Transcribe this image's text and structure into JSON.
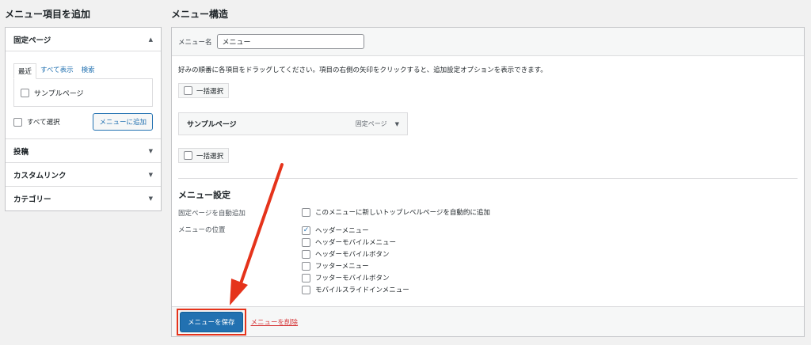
{
  "left": {
    "heading": "メニュー項目を追加",
    "pages_section": {
      "title": "固定ページ",
      "tabs": [
        "最近",
        "すべて表示",
        "検索"
      ],
      "items": [
        "サンプルページ"
      ],
      "select_all": "すべて選択",
      "add_button": "メニューに追加"
    },
    "sections": [
      "投稿",
      "カスタムリンク",
      "カテゴリー"
    ]
  },
  "right": {
    "heading": "メニュー構造",
    "name_label": "メニュー名",
    "name_value": "メニュー",
    "instructions": "好みの順番に各項目をドラッグしてください。項目の右側の矢印をクリックすると、追加設定オプションを表示できます。",
    "bulk_select": "一括選択",
    "menu_item": {
      "title": "サンプルページ",
      "type": "固定ページ"
    },
    "settings": {
      "title": "メニュー設定",
      "auto_add_label": "固定ページを自動追加",
      "auto_add_option": "このメニューに新しいトップレベルページを自動的に追加",
      "locations_label": "メニューの位置",
      "locations": [
        {
          "label": "ヘッダーメニュー",
          "checked": true
        },
        {
          "label": "ヘッダーモバイルメニュー",
          "checked": false
        },
        {
          "label": "ヘッダーモバイルボタン",
          "checked": false
        },
        {
          "label": "フッターメニュー",
          "checked": false
        },
        {
          "label": "フッターモバイルボタン",
          "checked": false
        },
        {
          "label": "モバイルスライドインメニュー",
          "checked": false
        }
      ]
    },
    "save_button": "メニューを保存",
    "delete_link": "メニューを削除"
  },
  "colors": {
    "accent": "#2271b1",
    "highlight": "#e5331b",
    "danger": "#d63638"
  }
}
